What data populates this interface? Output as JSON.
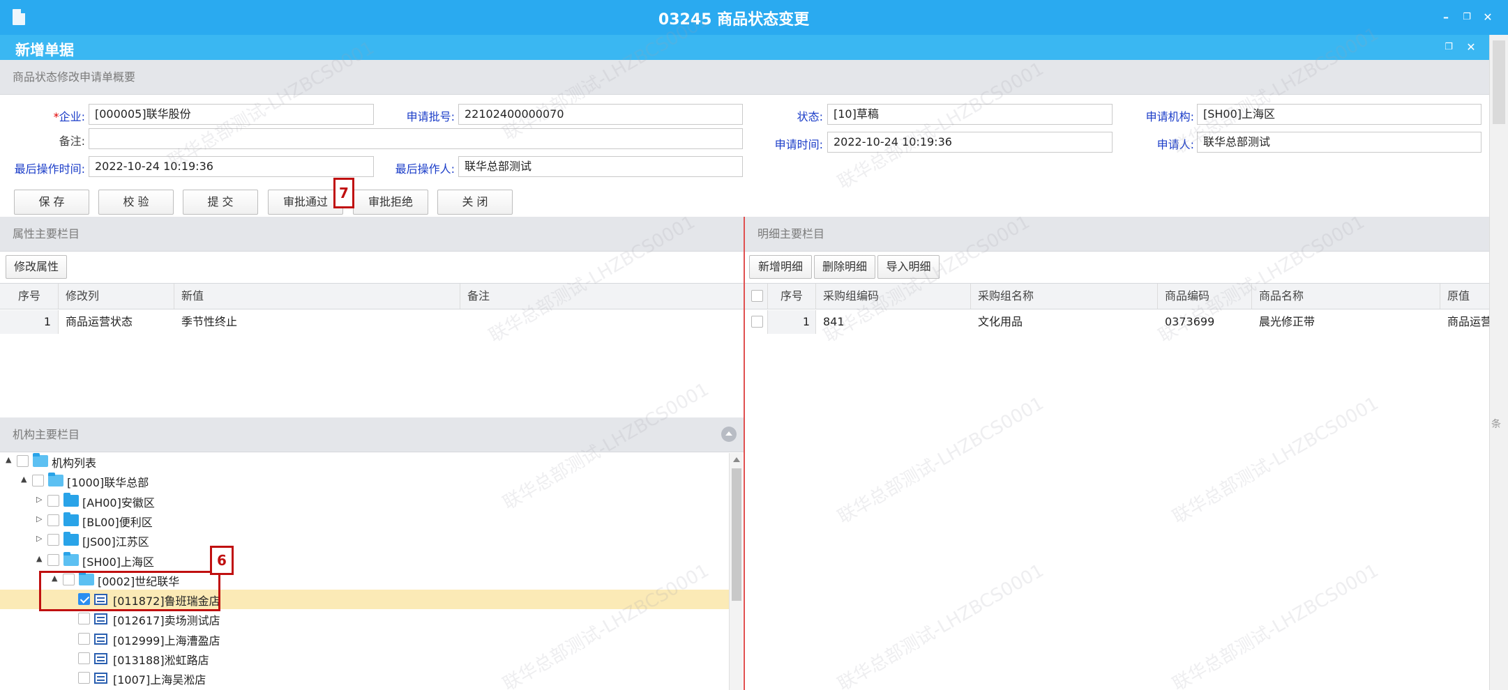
{
  "window": {
    "title": "03245 商品状态变更",
    "sub_title": "新增单据"
  },
  "side_tag": "条",
  "summary": {
    "header": "商品状态修改申请单概要",
    "fields": {
      "company": {
        "label": "企业:",
        "required_mark": "*",
        "value": "[000005]联华股份"
      },
      "batch_no": {
        "label": "申请批号:",
        "value": "22102400000070"
      },
      "status": {
        "label": "状态:",
        "value": "[10]草稿"
      },
      "org": {
        "label": "申请机构:",
        "value": "[SH00]上海区"
      },
      "remark": {
        "label": "备注:",
        "value": ""
      },
      "apply_time": {
        "label": "申请时间:",
        "value": "2022-10-24 10:19:36"
      },
      "applicant": {
        "label": "申请人:",
        "value": "联华总部测试"
      },
      "last_op_time": {
        "label": "最后操作时间:",
        "value": "2022-10-24 10:19:36"
      },
      "last_operator": {
        "label": "最后操作人:",
        "value": "联华总部测试"
      }
    }
  },
  "toolbar": {
    "save": "保 存",
    "validate": "校 验",
    "submit": "提 交",
    "approve": "审批通过",
    "reject": "审批拒绝",
    "close": "关 闭"
  },
  "callouts": {
    "step7": "7",
    "step6": "6"
  },
  "attr_section": {
    "header": "属性主要栏目",
    "modify_button": "修改属性",
    "columns": [
      "序号",
      "修改列",
      "新值",
      "备注"
    ],
    "rows": [
      {
        "no": "1",
        "column": "商品运营状态",
        "new_value": "季节性终止",
        "remark": ""
      }
    ]
  },
  "detail_section": {
    "header": "明细主要栏目",
    "buttons": {
      "add": "新增明细",
      "delete": "删除明细",
      "import": "导入明细"
    },
    "columns": [
      "序号",
      "采购组编码",
      "采购组名称",
      "商品编码",
      "商品名称",
      "原值"
    ],
    "rows": [
      {
        "no": "1",
        "group_code": "841",
        "group_name": "文化用品",
        "item_code": "0373699",
        "item_name": "晨光修正带",
        "orig_value": "商品运营状态:清场"
      }
    ]
  },
  "org_section": {
    "header": "机构主要栏目",
    "tree": [
      {
        "label": "机构列表",
        "level": 0,
        "type": "folder-open",
        "toggle": "▲",
        "checked": false
      },
      {
        "label": "[1000]联华总部",
        "level": 1,
        "type": "folder-open",
        "toggle": "▲",
        "checked": false
      },
      {
        "label": "[AH00]安徽区",
        "level": 2,
        "type": "folder",
        "toggle": "▷",
        "checked": false
      },
      {
        "label": "[BL00]便利区",
        "level": 2,
        "type": "folder",
        "toggle": "▷",
        "checked": false
      },
      {
        "label": "[JS00]江苏区",
        "level": 2,
        "type": "folder",
        "toggle": "▷",
        "checked": false
      },
      {
        "label": "[SH00]上海区",
        "level": 2,
        "type": "folder-open",
        "toggle": "▲",
        "checked": false
      },
      {
        "label": "[0002]世纪联华",
        "level": 3,
        "type": "folder-open",
        "toggle": "▲",
        "checked": false
      },
      {
        "label": "[011872]鲁班瑞金店",
        "level": 4,
        "type": "store",
        "toggle": "",
        "checked": true
      },
      {
        "label": "[012617]卖场测试店",
        "level": 4,
        "type": "store",
        "toggle": "",
        "checked": false
      },
      {
        "label": "[012999]上海漕盈店",
        "level": 4,
        "type": "store",
        "toggle": "",
        "checked": false
      },
      {
        "label": "[013188]淞虹路店",
        "level": 4,
        "type": "store",
        "toggle": "",
        "checked": false
      },
      {
        "label": "[1007]上海吴淞店",
        "level": 4,
        "type": "store",
        "toggle": "",
        "checked": false
      }
    ]
  },
  "watermark_text": "联华总部测试-LHZBCS0001",
  "colors": {
    "title_bar": "#2aaaf0",
    "sub_bar": "#3ab7f2",
    "label_blue": "#1a3cc8",
    "callout_red": "#c01010",
    "selected_row": "#fbeab6"
  }
}
